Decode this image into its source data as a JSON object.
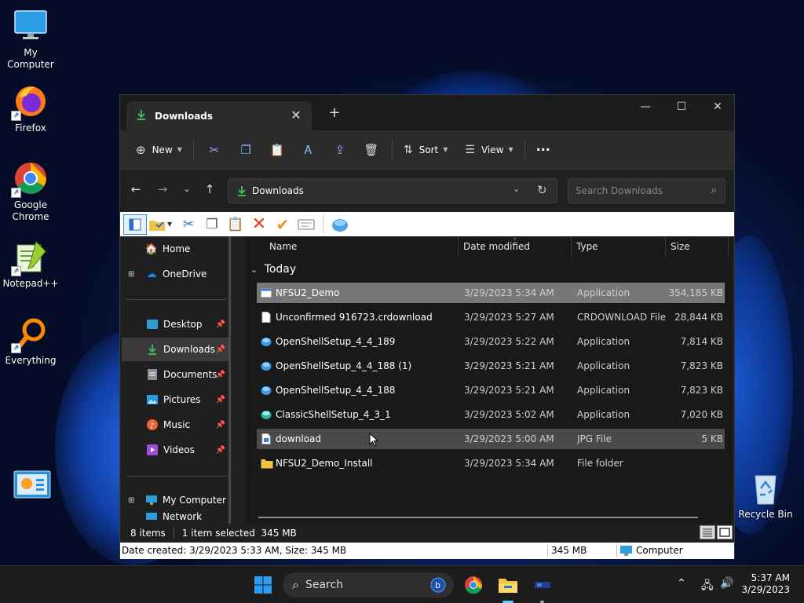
{
  "desktop": {
    "icons": [
      {
        "label": "My Computer",
        "icon": "monitor-icon"
      },
      {
        "label": "Firefox",
        "icon": "firefox-icon"
      },
      {
        "label": "Google Chrome",
        "icon": "chrome-icon"
      },
      {
        "label": "Notepad++",
        "icon": "notepadpp-icon"
      },
      {
        "label": "Everything",
        "icon": "everything-search-icon"
      },
      {
        "label": "",
        "icon": "control-panel-icon"
      },
      {
        "label": "Recycle Bin",
        "icon": "recycle-bin-icon"
      }
    ]
  },
  "window": {
    "tab_title": "Downloads",
    "toolbar": {
      "new_label": "New",
      "sort_label": "Sort",
      "view_label": "View",
      "more_label": "···"
    },
    "address": {
      "path": "Downloads",
      "search_placeholder": "Search Downloads"
    },
    "sidebar": {
      "items": [
        {
          "label": "Home",
          "icon": "home-icon"
        },
        {
          "label": "OneDrive",
          "icon": "onedrive-cloud-icon"
        },
        {
          "label": "Desktop",
          "icon": "desktop-folder-icon"
        },
        {
          "label": "Downloads",
          "icon": "download-arrow-icon"
        },
        {
          "label": "Documents",
          "icon": "documents-icon"
        },
        {
          "label": "Pictures",
          "icon": "pictures-icon"
        },
        {
          "label": "Music",
          "icon": "music-icon"
        },
        {
          "label": "Videos",
          "icon": "videos-icon"
        },
        {
          "label": "My Computer",
          "icon": "computer-icon"
        },
        {
          "label": "Network",
          "icon": "network-icon"
        }
      ]
    },
    "columns": [
      "Name",
      "Date modified",
      "Type",
      "Size"
    ],
    "group_label": "Today",
    "files": [
      {
        "name": "NFSU2_Demo",
        "date": "3/29/2023 5:34 AM",
        "type": "Application",
        "size": "354,185 KB",
        "icon": "application-icon"
      },
      {
        "name": "Unconfirmed 916723.crdownload",
        "date": "3/29/2023 5:27 AM",
        "type": "CRDOWNLOAD File",
        "size": "28,844 KB",
        "icon": "blank-file-icon"
      },
      {
        "name": "OpenShellSetup_4_4_189",
        "date": "3/29/2023 5:22 AM",
        "type": "Application",
        "size": "7,814 KB",
        "icon": "openshell-shell-icon"
      },
      {
        "name": "OpenShellSetup_4_4_188 (1)",
        "date": "3/29/2023 5:21 AM",
        "type": "Application",
        "size": "7,823 KB",
        "icon": "openshell-shell-icon"
      },
      {
        "name": "OpenShellSetup_4_4_188",
        "date": "3/29/2023 5:21 AM",
        "type": "Application",
        "size": "7,823 KB",
        "icon": "openshell-shell-icon"
      },
      {
        "name": "ClassicShellSetup_4_3_1",
        "date": "3/29/2023 5:02 AM",
        "type": "Application",
        "size": "7,020 KB",
        "icon": "classicshell-shell-icon"
      },
      {
        "name": "download",
        "date": "3/29/2023 5:00 AM",
        "type": "JPG File",
        "size": "5 KB",
        "icon": "image-file-icon"
      },
      {
        "name": "NFSU2_Demo_Install",
        "date": "3/29/2023 5:34 AM",
        "type": "File folder",
        "size": "",
        "icon": "folder-icon"
      }
    ],
    "status": {
      "count": "8 items",
      "selected": "1 item selected  345 MB"
    },
    "details": {
      "info": "Date created: 3/29/2023 5:33 AM, Size: 345 MB",
      "size": "345 MB",
      "location": "Computer"
    }
  },
  "taskbar": {
    "search_label": "Search",
    "time": "5:37 AM",
    "date": "3/29/2023"
  },
  "colors": {
    "accent": "#0078d4",
    "selection": "#777777",
    "folder": "#f5c542",
    "download_green": "#3fb950"
  }
}
